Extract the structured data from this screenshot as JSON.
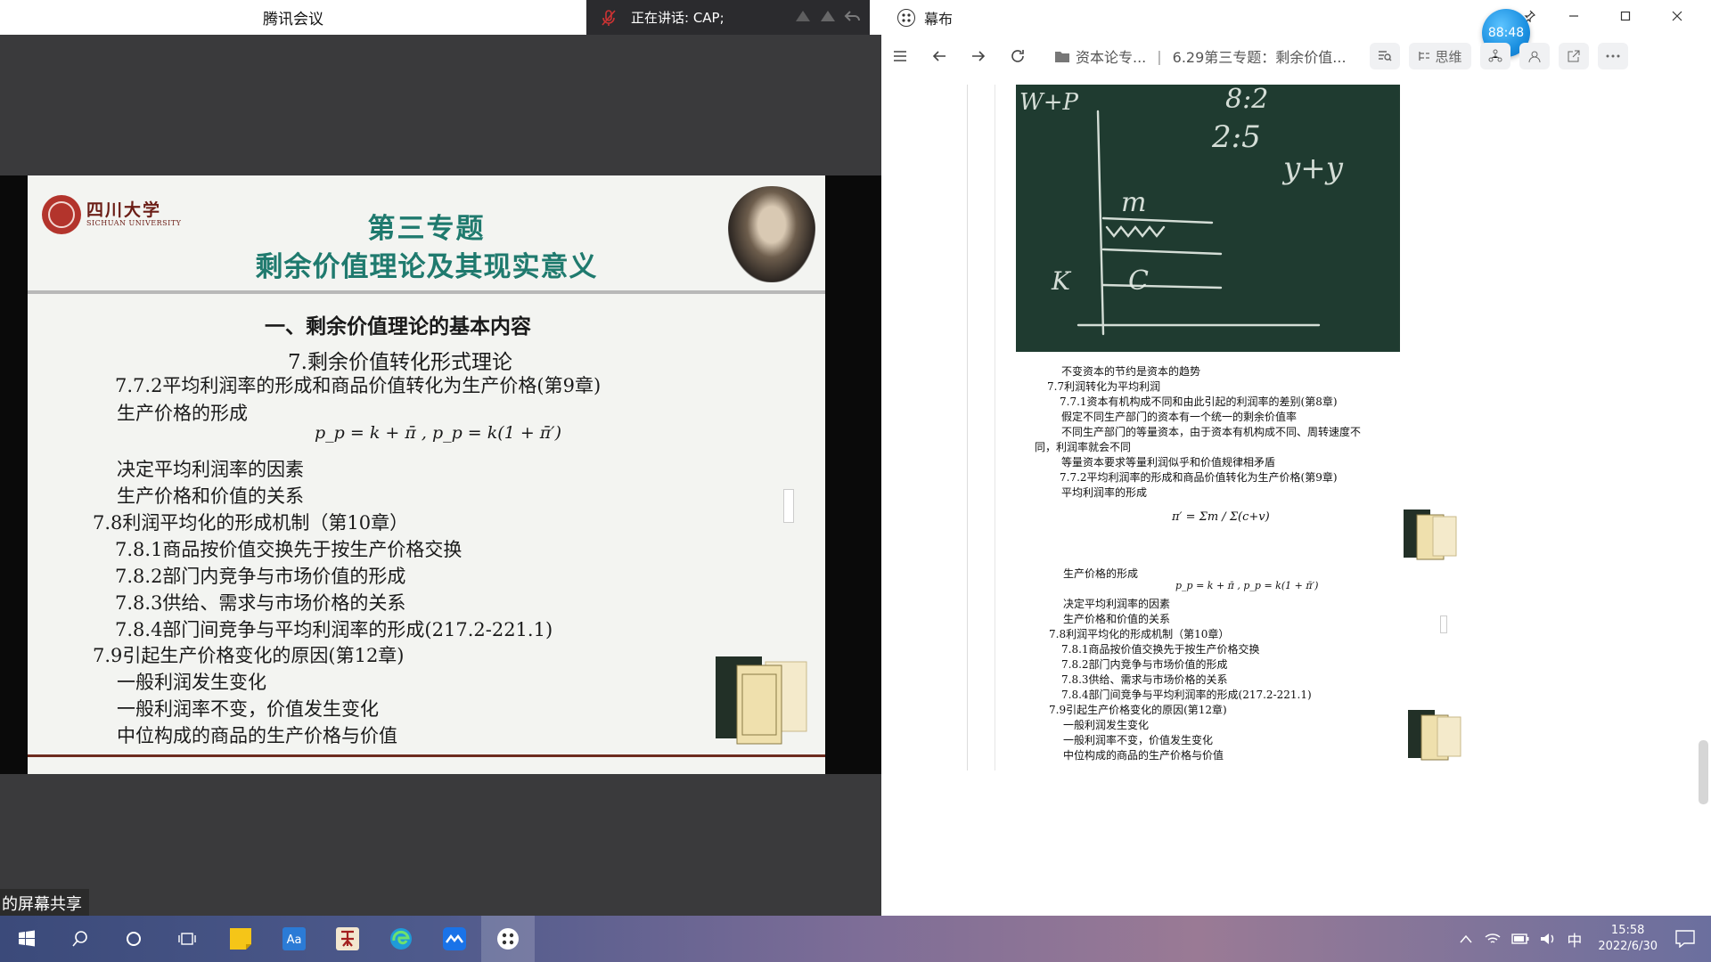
{
  "meeting": {
    "title": "腾讯会议",
    "speaking": "正在讲话: CAP;",
    "share_label": "的屏幕共享"
  },
  "slide": {
    "university_cn": "四川大学",
    "university_en": "SICHUAN UNIVERSITY",
    "title1": "第三专题",
    "title2": "剩余价值理论及其现实意义",
    "lines": [
      "一、剩余价值理论的基本内容",
      "7.剩余价值转化形式理论",
      "7.7.2平均利润率的形成和商品价值转化为生产价格(第9章)",
      "生产价格的形成",
      "p_p = k + π̄ ,  p_p = k(1 + π̄′)",
      "决定平均利润率的因素",
      "生产价格和价值的关系",
      "7.8利润平均化的形成机制（第10章）",
      "7.8.1商品按价值交换先于按生产价格交换",
      "7.8.2部门内竞争与市场价值的形成",
      "7.8.3供给、需求与市场价格的关系",
      "7.8.4部门间竞争与平均利润率的形成(217.2-221.1)",
      "7.9引起生产价格变化的原因(第12章)",
      "一般利润发生变化",
      "一般利润率不变，价值发生变化",
      "中位构成的商品的生产价格与价值"
    ]
  },
  "mubu": {
    "app_title": "幕布",
    "timer": "88:48",
    "breadcrumb_folder": "资本论专...",
    "breadcrumb_sep": "|",
    "breadcrumb_doc": "6.29第三专题：剩余价值...",
    "mindmap_label": "思维",
    "doc_lines": [
      "不变资本的节约是资本的趋势",
      "7.7利润转化为平均利润",
      "7.7.1资本有机构成不同和由此引起的利润率的差别(第8章)",
      "假定不同生产部门的资本有一个统一的剩余价值率",
      "不同生产部门的等量资本，由于资本有机构成不同、周转速度不",
      "同，利润率就会不同",
      "等量资本要求等量利润似乎和价值规律相矛盾",
      "7.7.2平均利润率的形成和商品价值转化为生产价格(第9章)",
      "平均利润率的形成",
      "生产价格的形成",
      "决定平均利润率的因素",
      "生产价格和价值的关系",
      "7.8利润平均化的形成机制（第10章）",
      "7.8.1商品按价值交换先于按生产价格交换",
      "7.8.2部门内竞争与市场价值的形成",
      "7.8.3供给、需求与市场价格的关系",
      "7.8.4部门间竞争与平均利润率的形成(217.2-221.1)",
      "7.9引起生产价格变化的原因(第12章)",
      "一般利润发生变化",
      "一般利润率不变，价值发生变化",
      "中位构成的商品的生产价格与价值"
    ],
    "formula_avg": "π′ = Σm / Σ(c+v)",
    "formula_price": "p_p = k + π̄ ,  p_p = k(1 + π̄′)",
    "board_text": [
      "W+P",
      "8:2",
      "2:5",
      "y+y",
      "C",
      "m",
      "K"
    ]
  },
  "taskbar": {
    "ime": "中",
    "time": "15:58",
    "date": "2022/6/30"
  }
}
